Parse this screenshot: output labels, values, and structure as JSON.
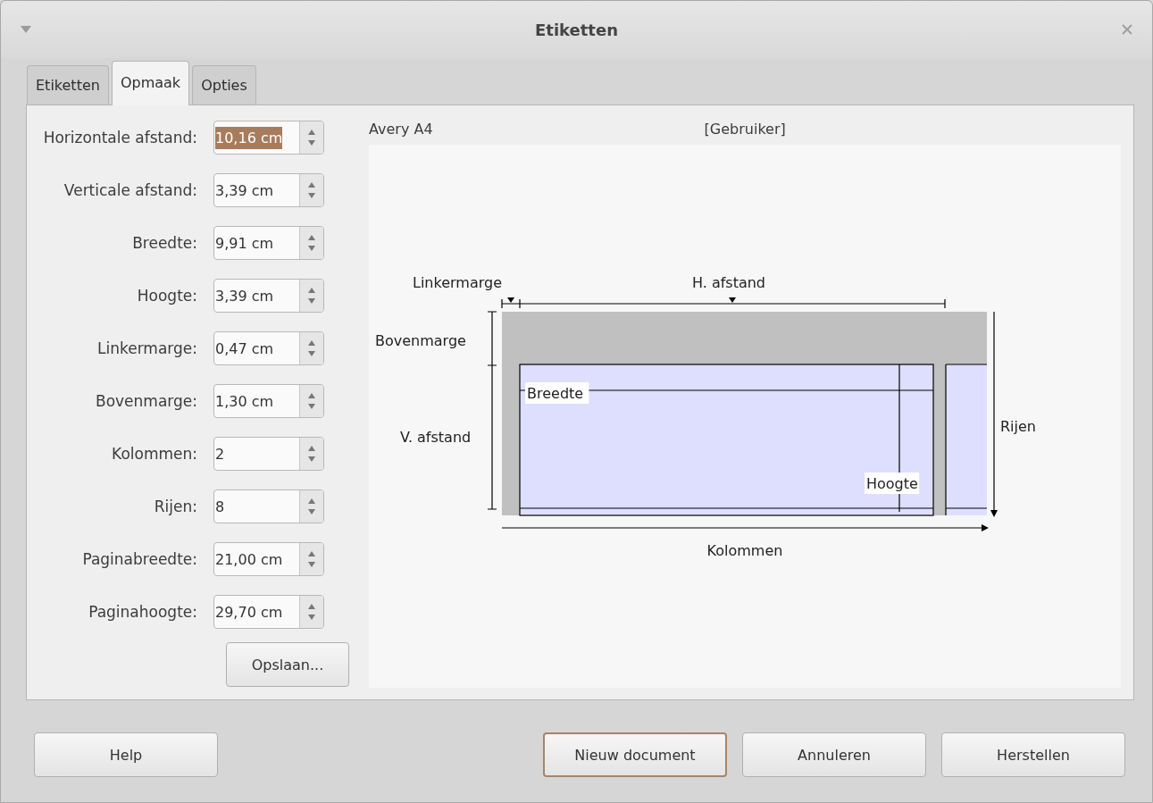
{
  "window": {
    "title": "Etiketten"
  },
  "tabs": [
    {
      "label": "Etiketten",
      "selected": false
    },
    {
      "label": "Opmaak",
      "selected": true
    },
    {
      "label": "Opties",
      "selected": false
    }
  ],
  "fields": [
    {
      "label": "Horizontale afstand:",
      "value": "10,16 cm",
      "highlighted": true
    },
    {
      "label": "Verticale afstand:",
      "value": "3,39 cm",
      "highlighted": false
    },
    {
      "label": "Breedte:",
      "value": "9,91 cm",
      "highlighted": false
    },
    {
      "label": "Hoogte:",
      "value": "3,39 cm",
      "highlighted": false
    },
    {
      "label": "Linkermarge:",
      "value": "0,47 cm",
      "highlighted": false
    },
    {
      "label": "Bovenmarge:",
      "value": "1,30 cm",
      "highlighted": false
    },
    {
      "label": "Kolommen:",
      "value": "2",
      "highlighted": false
    },
    {
      "label": "Rijen:",
      "value": "8",
      "highlighted": false
    },
    {
      "label": "Paginabreedte:",
      "value": "21,00 cm",
      "highlighted": false
    },
    {
      "label": "Paginahoogte:",
      "value": "29,70 cm",
      "highlighted": false
    }
  ],
  "save_button": "Opslaan...",
  "preview": {
    "brand": "Avery A4",
    "type": "[Gebruiker]",
    "labels": [
      {
        "kind": "left-margin",
        "text": "Linkermarge"
      },
      {
        "kind": "h-spacing",
        "text": "H. afstand"
      },
      {
        "kind": "top-margin",
        "text": "Bovenmarge"
      },
      {
        "kind": "v-spacing",
        "text": "V. afstand"
      },
      {
        "kind": "width",
        "text": "Breedte"
      },
      {
        "kind": "height",
        "text": "Hoogte"
      },
      {
        "kind": "rows",
        "text": "Rijen"
      },
      {
        "kind": "columns",
        "text": "Kolommen"
      }
    ]
  },
  "buttons": [
    {
      "label": "Help",
      "focused": false
    },
    {
      "label": "Nieuw document",
      "focused": true
    },
    {
      "label": "Annuleren",
      "focused": false
    },
    {
      "label": "Herstellen",
      "focused": false
    }
  ]
}
